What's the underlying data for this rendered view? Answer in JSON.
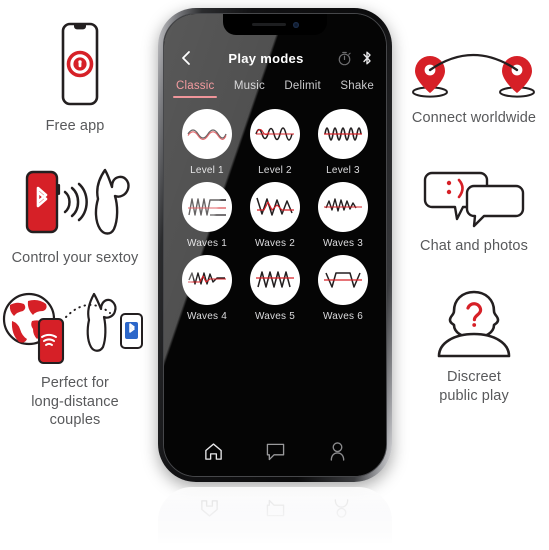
{
  "app": {
    "title": "Play modes",
    "back_icon": "chevron-left-icon",
    "header_icons": [
      "timer-icon",
      "bluetooth-icon"
    ],
    "tabs": [
      {
        "label": "Classic",
        "active": true
      },
      {
        "label": "Music",
        "active": false
      },
      {
        "label": "Delimit",
        "active": false
      },
      {
        "label": "Shake",
        "active": false
      }
    ],
    "modes": [
      {
        "label": "Level 1",
        "icon": "waveform-level-1-icon"
      },
      {
        "label": "Level 2",
        "icon": "waveform-level-2-icon"
      },
      {
        "label": "Level 3",
        "icon": "waveform-level-3-icon"
      },
      {
        "label": "Waves 1",
        "icon": "waveform-waves-1-icon"
      },
      {
        "label": "Waves 2",
        "icon": "waveform-waves-2-icon"
      },
      {
        "label": "Waves 3",
        "icon": "waveform-waves-3-icon"
      },
      {
        "label": "Waves 4",
        "icon": "waveform-waves-4-icon"
      },
      {
        "label": "Waves 5",
        "icon": "waveform-waves-5-icon"
      },
      {
        "label": "Waves 6",
        "icon": "waveform-waves-6-icon"
      }
    ],
    "bottom_nav": [
      {
        "icon": "home-icon",
        "label": "Home"
      },
      {
        "icon": "chat-bubble-icon",
        "label": "Chat"
      },
      {
        "icon": "person-icon",
        "label": "Profile"
      }
    ]
  },
  "features_left": [
    {
      "caption": "Free app",
      "icon": "phone-lock-icon"
    },
    {
      "caption": "Control your sextoy",
      "icon": "phone-bluetooth-toy-icon"
    },
    {
      "caption": "Perfect for\nlong-distance\ncouples",
      "caption_lines": [
        "Perfect for",
        "long-distance",
        "couples"
      ],
      "icon": "globe-remote-toy-icon"
    }
  ],
  "features_right": [
    {
      "caption": "Connect worldwide",
      "icon": "map-pins-arc-icon"
    },
    {
      "caption": "Chat and photos",
      "icon": "speech-bubbles-smiley-icon"
    },
    {
      "caption": "Discreet\npublic play",
      "caption_lines": [
        "Discreet",
        "public play"
      ],
      "icon": "person-question-icon"
    }
  ],
  "colors": {
    "accent_red": "#D62027",
    "accent_pink": "#E8646B",
    "caption_gray": "#58595B",
    "screen_black": "#050505",
    "outline_dark": "#231F20"
  }
}
